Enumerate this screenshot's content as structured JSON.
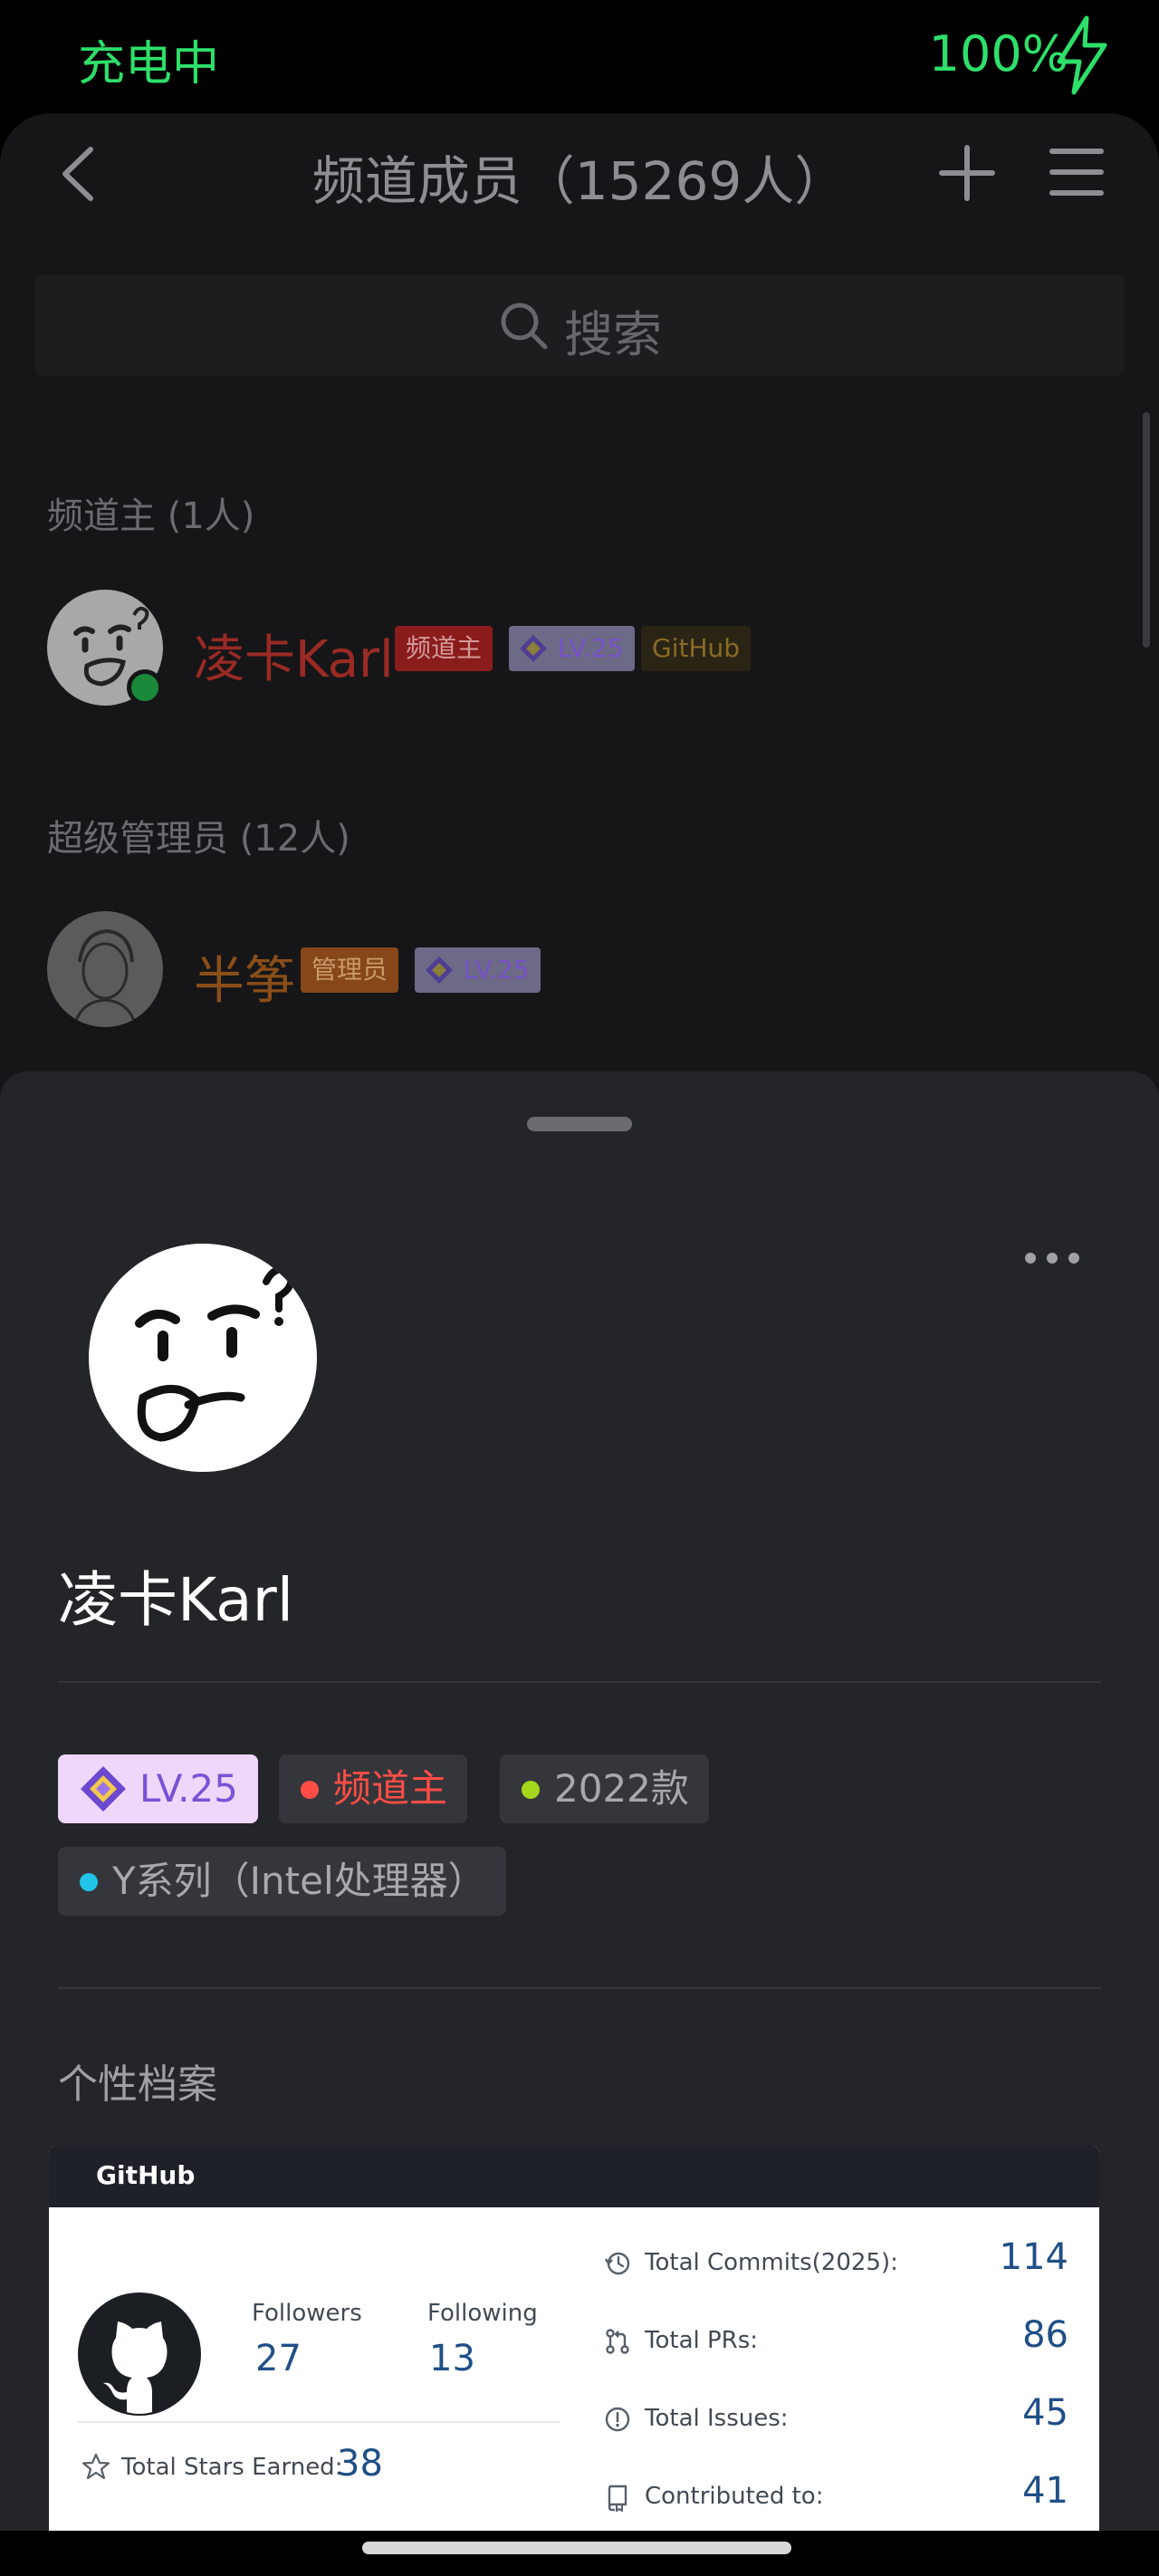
{
  "status_bar": {
    "charging_label": "充电中",
    "battery": "100%"
  },
  "nav": {
    "title": "频道成员（15269人）",
    "back_icon": "chevron-left-icon",
    "add_icon": "plus-icon",
    "menu_icon": "hamburger-icon"
  },
  "search": {
    "placeholder": "搜索",
    "icon": "search-icon"
  },
  "sections": [
    {
      "title": "频道主 (1人)",
      "member": {
        "name": "凌卡Karl",
        "tags": [
          "频道主",
          "LV.25",
          "GitHub"
        ]
      }
    },
    {
      "title": "超级管理员 (12人)",
      "member": {
        "name": "半筝",
        "tags": [
          "管理员",
          "LV.25"
        ]
      }
    }
  ],
  "profile": {
    "name": "凌卡Karl",
    "chips": [
      {
        "label": "LV.25"
      },
      {
        "label": "频道主",
        "dot_color": "#ff4d45"
      },
      {
        "label": "2022款",
        "dot_color": "#a4d61c"
      },
      {
        "label": "Y系列（Intel处理器）",
        "dot_color": "#1fc4e8"
      }
    ],
    "archive_title": "个性档案"
  },
  "github": {
    "header": "GitHub",
    "followers_label": "Followers",
    "followers": "27",
    "following_label": "Following",
    "following": "13",
    "stars_label": "Total Stars Earned:",
    "stars": "38",
    "stats": [
      {
        "label": "Total Commits(2025):",
        "value": "114",
        "icon": "history-icon"
      },
      {
        "label": "Total PRs:",
        "value": "86",
        "icon": "pull-request-icon"
      },
      {
        "label": "Total Issues:",
        "value": "45",
        "icon": "issue-icon"
      },
      {
        "label": "Contributed to:",
        "value": "41",
        "icon": "repo-icon"
      }
    ]
  },
  "colors": {
    "accent_green": "#2ee06a",
    "owner_red": "#ff4d45",
    "admin_orange": "#c06b1c",
    "lv_purple": "#7a52d6"
  }
}
